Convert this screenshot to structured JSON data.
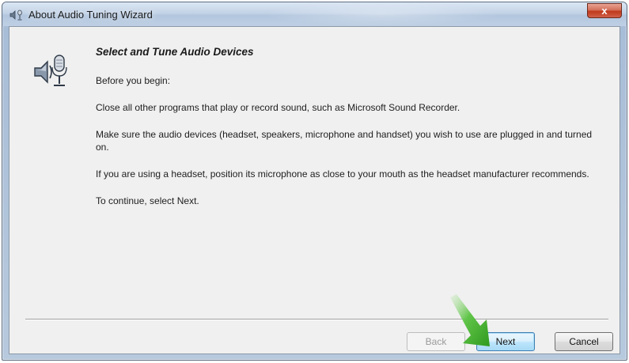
{
  "window": {
    "title": "About Audio Tuning Wizard",
    "close_glyph": "x",
    "app_icon": "microphone-speaker-icon"
  },
  "page": {
    "header_icon": "microphone-speaker-icon",
    "heading": "Select and Tune Audio Devices",
    "paragraphs": [
      "Before you begin:",
      "Close all other programs that play or record sound, such as Microsoft Sound Recorder.",
      "Make sure the audio devices (headset, speakers, microphone and handset) you wish to use are plugged in and turned on.",
      "If you are using a headset, position its microphone as close to your mouth as the headset manufacturer recommends.",
      "To continue, select Next."
    ]
  },
  "buttons": {
    "back_label": "Back",
    "back_enabled": false,
    "next_label": "Next",
    "cancel_label": "Cancel"
  },
  "annotation": {
    "arrow_color": "#3fae2a",
    "points_to": "next-button"
  }
}
